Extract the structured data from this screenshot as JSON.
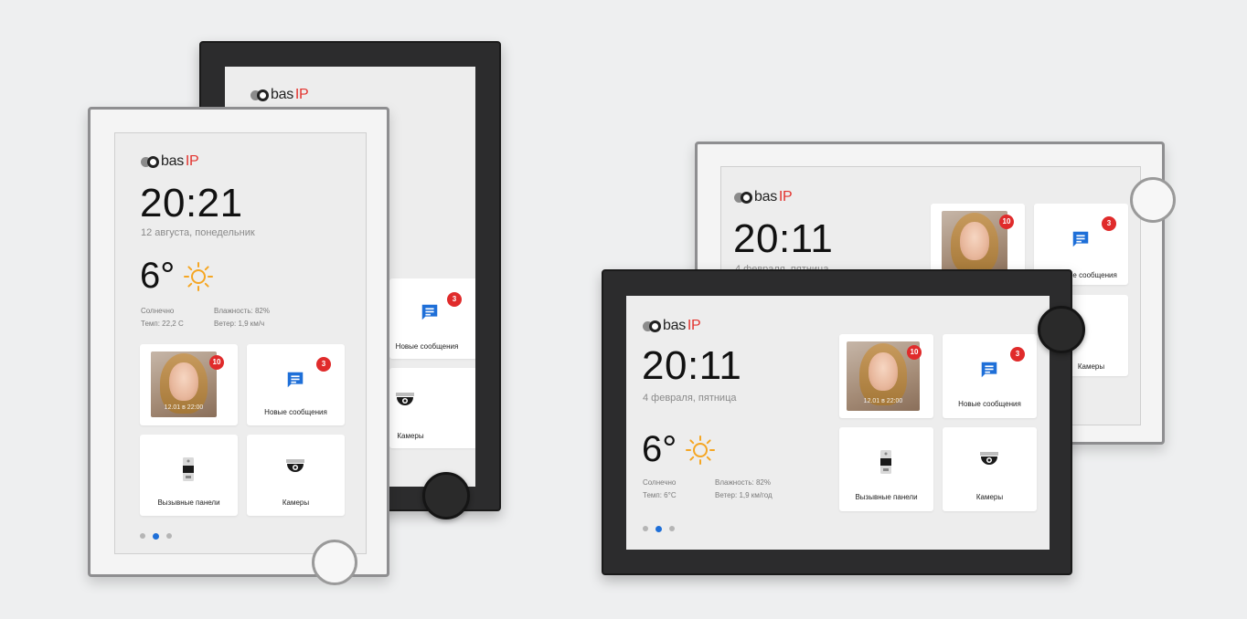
{
  "logo": {
    "brand": "bas",
    "suffix": "IP"
  },
  "portrait_front": {
    "time": "20:21",
    "date": "12 августа, понедельник",
    "temperature": "6°",
    "weather_condition": "Солнечно",
    "feels_like": "Темп: 22,2 С",
    "humidity": "Влажность: 82%",
    "wind": "Ветер: 1,9 км/ч",
    "tiles": {
      "video_badge": "10",
      "video_timestamp": "12.01 в 22:00",
      "messages_label": "Новые сообщения",
      "messages_badge": "3",
      "panels_label": "Вызывные панели",
      "cameras_label": "Камеры"
    }
  },
  "portrait_back": {
    "messages_label": "Новые сообщения",
    "messages_badge": "3",
    "cameras_label": "Камеры"
  },
  "landscape_front": {
    "time": "20:11",
    "date": "4 февраля, пятница",
    "temperature": "6°",
    "weather_condition": "Солнечно",
    "feels_like": "Темп: 6°С",
    "humidity": "Влажность: 82%",
    "wind": "Ветер: 1,9 км/год",
    "tiles": {
      "video_badge": "10",
      "video_timestamp": "12.01 в 22:00",
      "messages_label": "Новые сообщения",
      "messages_badge": "3",
      "panels_label": "Вызывные панели",
      "cameras_label": "Камеры"
    }
  },
  "landscape_back": {
    "time": "20:11",
    "date": "4 февраля, пятница",
    "video_badge": "10",
    "messages_badge": "3",
    "messages_label": "Новые сообщения",
    "cameras_label": "Камеры"
  },
  "colors": {
    "accent_blue": "#1e6fd8",
    "badge_red": "#e02b2b",
    "sun": "#f5a623",
    "logo_ip": "#e3342f"
  },
  "icons": [
    "message-icon",
    "camera-icon",
    "intercom-panel-icon",
    "sun-icon"
  ],
  "pager": {
    "pages": 3,
    "active_index": 1
  }
}
